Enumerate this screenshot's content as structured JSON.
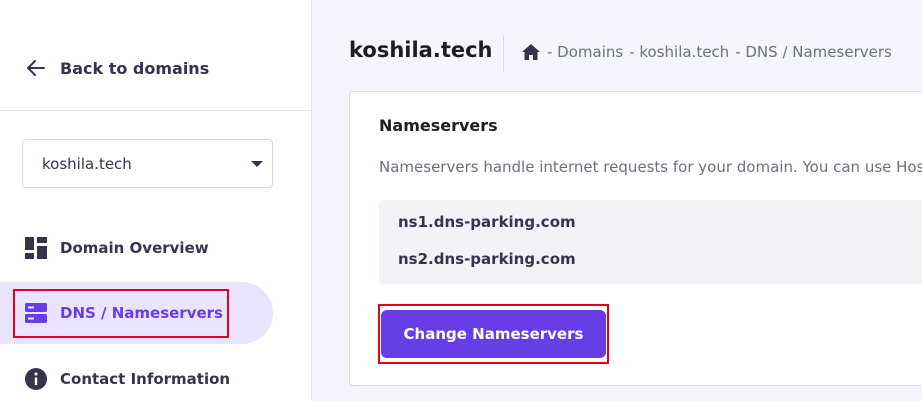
{
  "sidebar": {
    "back_label": "Back to domains",
    "domain_select": {
      "value": "koshila.tech"
    },
    "items": [
      {
        "label": "Domain Overview",
        "icon": "grid-icon",
        "active": false
      },
      {
        "label": "DNS / Nameservers",
        "icon": "server-icon",
        "active": true
      },
      {
        "label": "Contact Information",
        "icon": "info-icon",
        "active": false
      }
    ]
  },
  "header": {
    "title": "koshila.tech",
    "breadcrumb": [
      "- Domains",
      "- koshila.tech",
      "- DNS / Nameservers"
    ]
  },
  "card": {
    "title": "Nameservers",
    "description": "Nameservers handle internet requests for your domain. You can use Hos",
    "nameservers": [
      "ns1.dns-parking.com",
      "ns2.dns-parking.com"
    ],
    "button_label": "Change Nameservers"
  },
  "colors": {
    "accent": "#673de6",
    "active_bg": "#ebe4ff",
    "highlight": "#e5001c"
  }
}
